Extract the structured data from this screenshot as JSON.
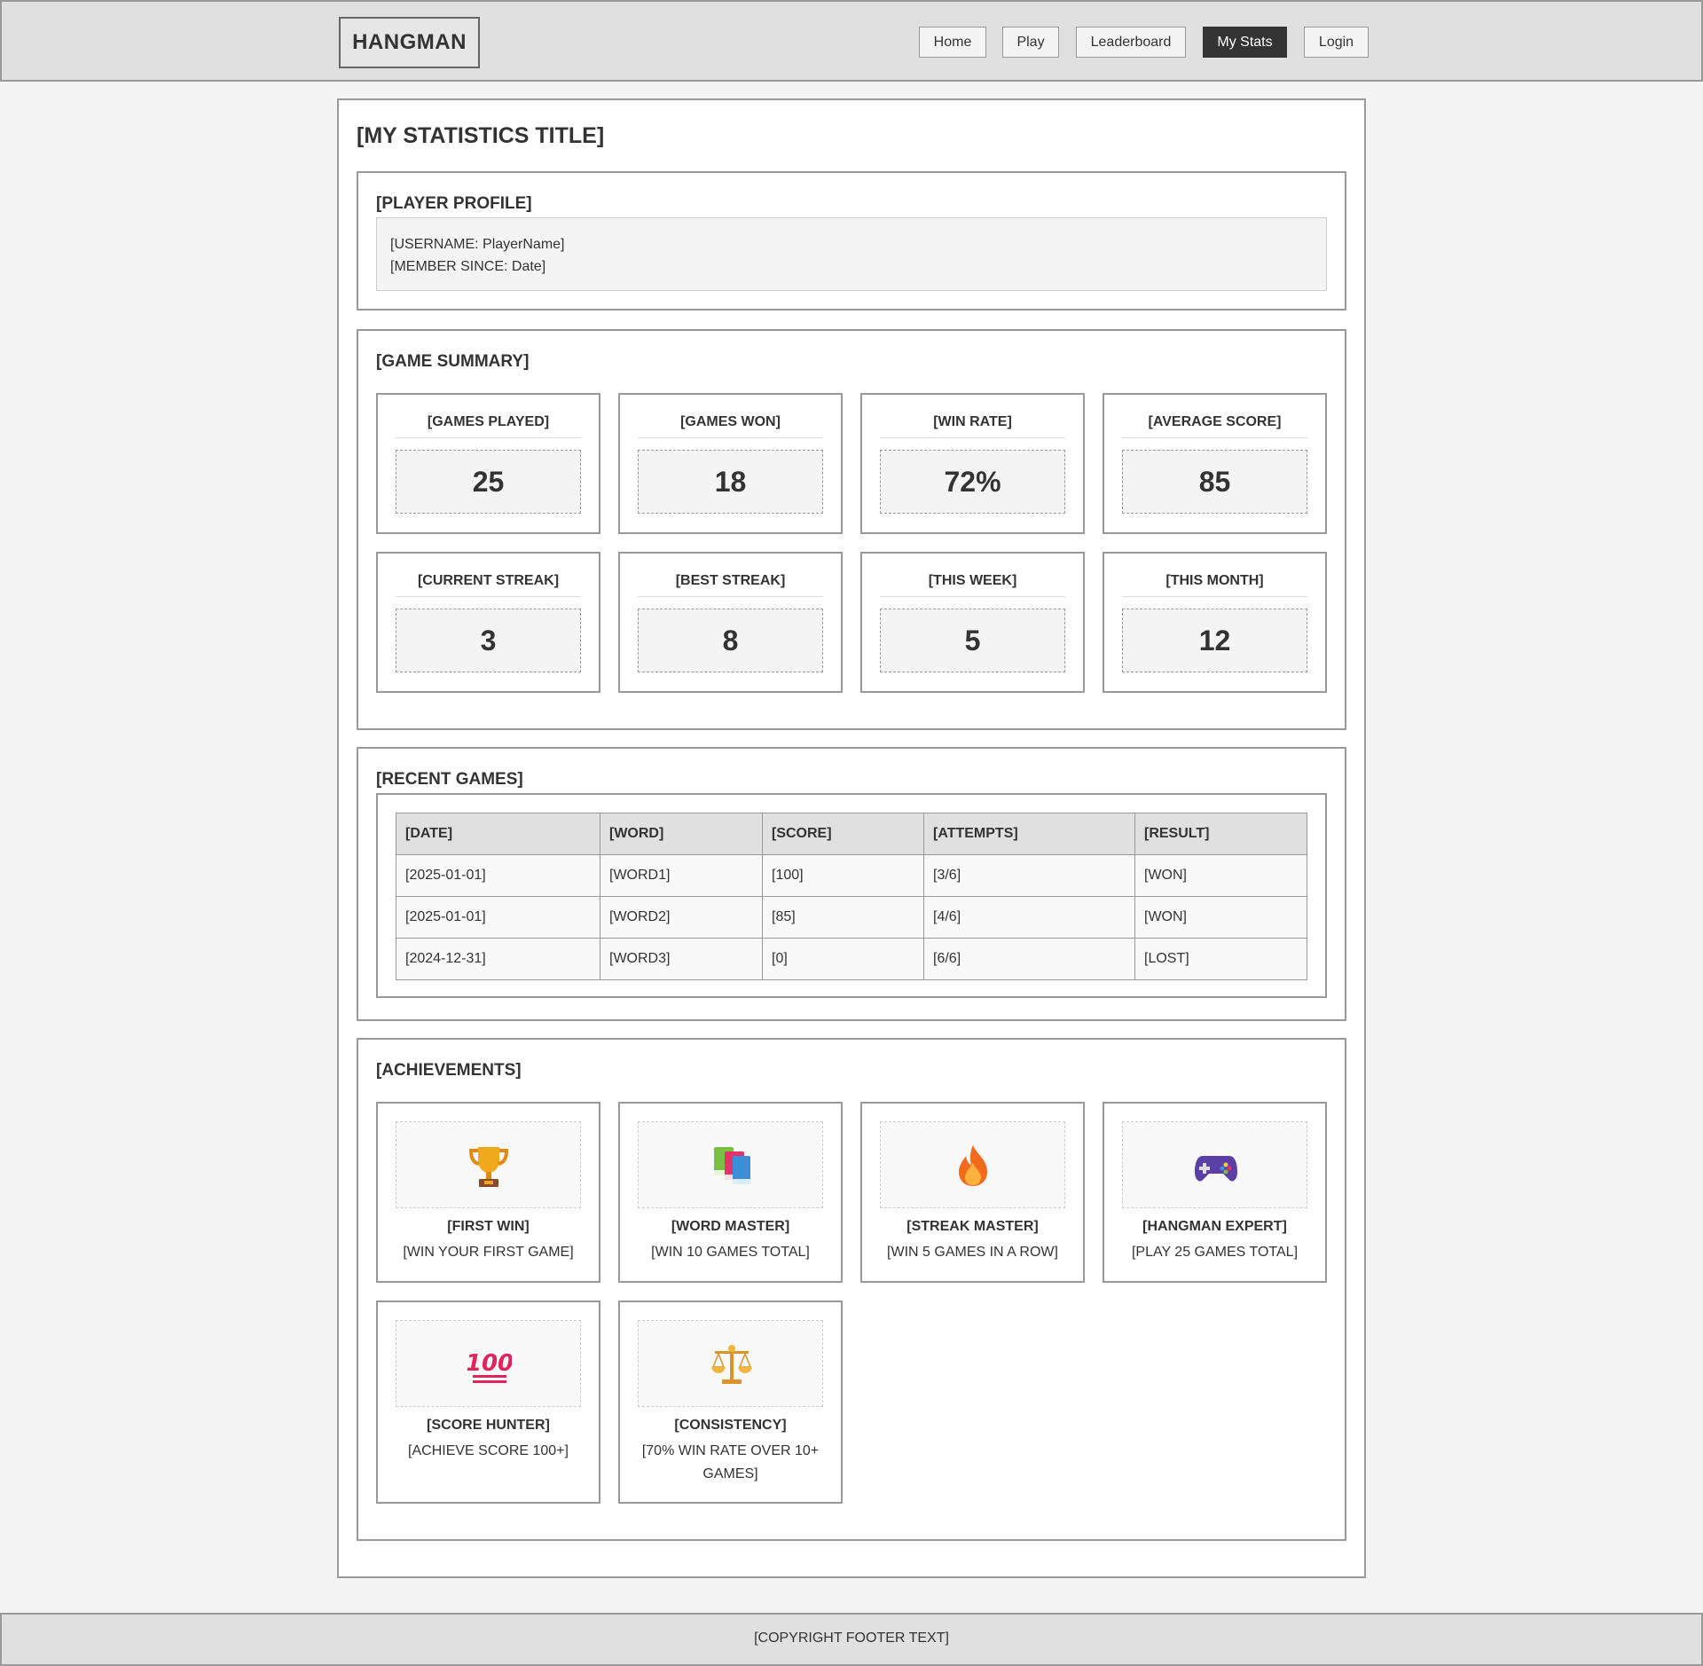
{
  "header": {
    "logo": "HANGMAN",
    "nav": [
      "Home",
      "Play",
      "Leaderboard",
      "My Stats",
      "Login"
    ],
    "active_nav": "My Stats"
  },
  "page_title": "[MY STATISTICS TITLE]",
  "profile": {
    "title": "[PLAYER PROFILE]",
    "username": "[USERNAME: PlayerName]",
    "member_since": "[MEMBER SINCE: Date]"
  },
  "summary": {
    "title": "[GAME SUMMARY]",
    "stats": [
      {
        "label": "[GAMES PLAYED]",
        "value": "25"
      },
      {
        "label": "[GAMES WON]",
        "value": "18"
      },
      {
        "label": "[WIN RATE]",
        "value": "72%"
      },
      {
        "label": "[AVERAGE SCORE]",
        "value": "85"
      },
      {
        "label": "[CURRENT STREAK]",
        "value": "3"
      },
      {
        "label": "[BEST STREAK]",
        "value": "8"
      },
      {
        "label": "[THIS WEEK]",
        "value": "5"
      },
      {
        "label": "[THIS MONTH]",
        "value": "12"
      }
    ]
  },
  "recent": {
    "title": "[RECENT GAMES]",
    "columns": [
      "[DATE]",
      "[WORD]",
      "[SCORE]",
      "[ATTEMPTS]",
      "[RESULT]"
    ],
    "rows": [
      [
        "[2025-01-01]",
        "[WORD1]",
        "[100]",
        "[3/6]",
        "[WON]"
      ],
      [
        "[2025-01-01]",
        "[WORD2]",
        "[85]",
        "[4/6]",
        "[WON]"
      ],
      [
        "[2024-12-31]",
        "[WORD3]",
        "[0]",
        "[6/6]",
        "[LOST]"
      ]
    ]
  },
  "achievements": {
    "title": "[ACHIEVEMENTS]",
    "items": [
      {
        "icon": "trophy-icon",
        "title": "[FIRST WIN]",
        "desc": "[WIN YOUR FIRST GAME]"
      },
      {
        "icon": "books-icon",
        "title": "[WORD MASTER]",
        "desc": "[WIN 10 GAMES TOTAL]"
      },
      {
        "icon": "fire-icon",
        "title": "[STREAK MASTER]",
        "desc": "[WIN 5 GAMES IN A ROW]"
      },
      {
        "icon": "gamepad-icon",
        "title": "[HANGMAN EXPERT]",
        "desc": "[PLAY 25 GAMES TOTAL]"
      },
      {
        "icon": "hundred-icon",
        "title": "[SCORE HUNTER]",
        "desc": "[ACHIEVE SCORE 100+]"
      },
      {
        "icon": "balance-scale-icon",
        "title": "[CONSISTENCY]",
        "desc": "[70% WIN RATE OVER 10+ GAMES]"
      }
    ]
  },
  "footer": "[COPYRIGHT FOOTER TEXT]"
}
